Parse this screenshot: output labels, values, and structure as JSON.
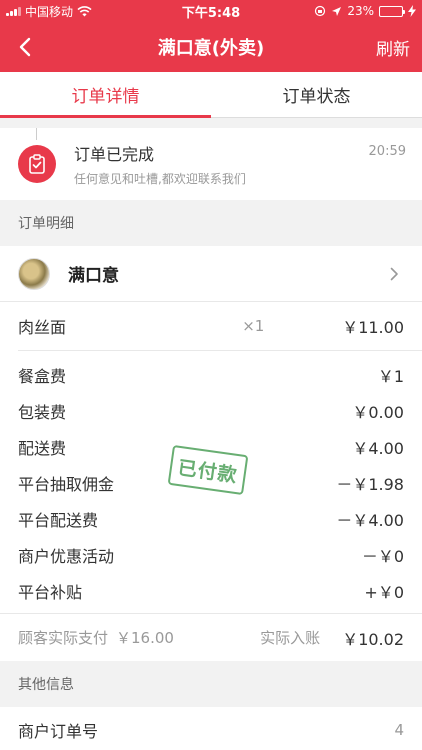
{
  "status_bar": {
    "carrier": "中国移动",
    "time": "下午5:48",
    "battery": "23%",
    "battery_level": 0.23
  },
  "nav": {
    "title": "满口意(外卖)",
    "refresh_label": "刷新"
  },
  "tabs": [
    {
      "label": "订单详情",
      "active": true
    },
    {
      "label": "订单状态",
      "active": false
    }
  ],
  "order_status": {
    "title": "订单已完成",
    "subtitle": "任何意见和吐槽,都欢迎联系我们",
    "time": "20:59"
  },
  "detail_section": {
    "header": "订单明细",
    "shop_name": "满口意",
    "item": {
      "name": "肉丝面",
      "qty": "×1",
      "price": "￥11.00"
    },
    "fees": [
      {
        "label": "餐盒费",
        "value": "￥1"
      },
      {
        "label": "包装费",
        "value": "￥0.00"
      },
      {
        "label": "配送费",
        "value": "￥4.00"
      },
      {
        "label": "平台抽取佣金",
        "value": "－￥1.98"
      },
      {
        "label": "平台配送费",
        "value": "－￥4.00"
      },
      {
        "label": "商户优惠活动",
        "value": "－￥0"
      },
      {
        "label": "平台补贴",
        "value": "+￥0"
      }
    ],
    "summary": {
      "pay_label": "顾客实际支付",
      "pay_value": "￥16.00",
      "income_label": "实际入账",
      "income_value": "￥10.02"
    },
    "stamp_text": "已付款"
  },
  "other_section": {
    "header": "其他信息",
    "rows": [
      {
        "label": "商户订单号",
        "value": "4"
      }
    ]
  },
  "colors": {
    "accent": "#e8394a",
    "stamp": "#4ea05a"
  }
}
